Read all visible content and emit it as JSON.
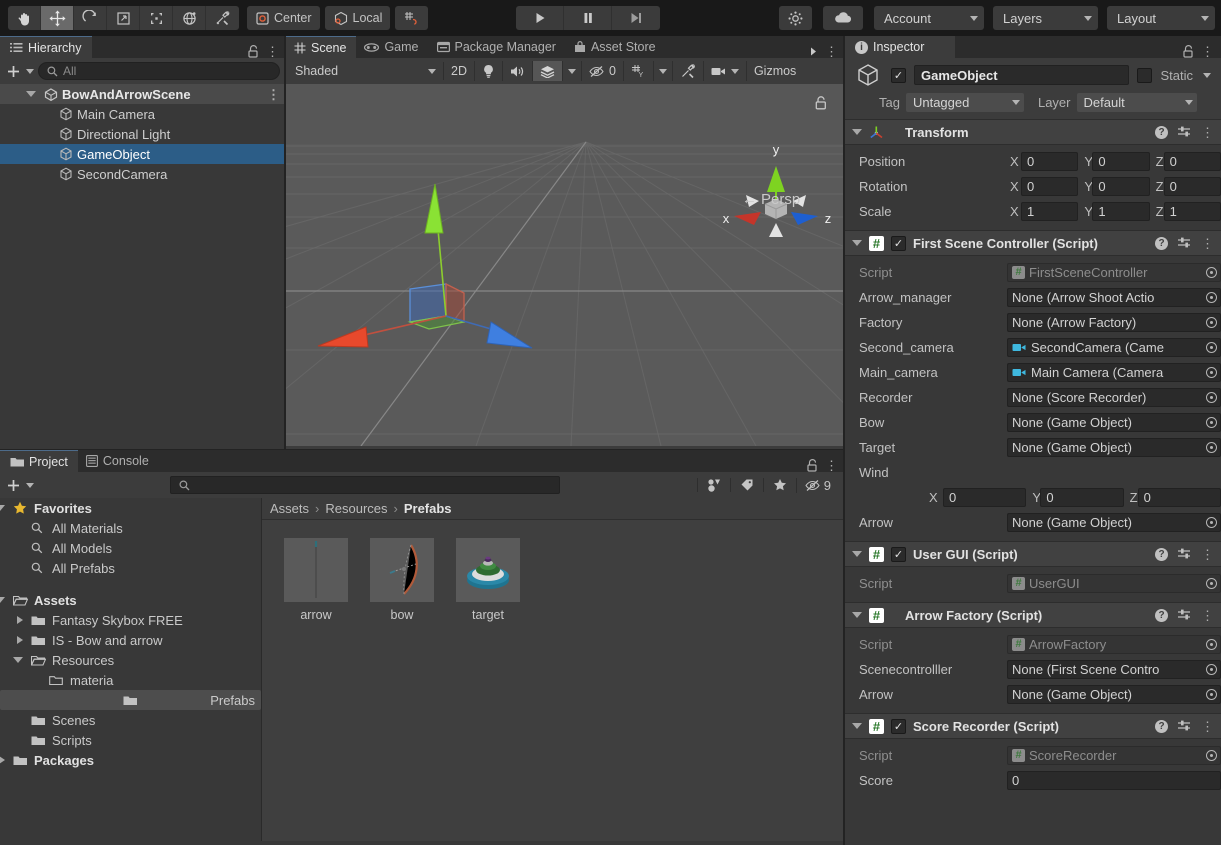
{
  "toolbar": {
    "tools": [
      {
        "name": "hand-tool",
        "icon": "hand",
        "active": false
      },
      {
        "name": "move-tool",
        "icon": "move",
        "active": true
      },
      {
        "name": "rotate-tool",
        "icon": "rotate",
        "active": false
      },
      {
        "name": "scale-tool",
        "icon": "scale",
        "active": false
      },
      {
        "name": "rect-tool",
        "icon": "rect",
        "active": false
      },
      {
        "name": "transform-tool",
        "icon": "transform",
        "active": false
      },
      {
        "name": "custom-tool",
        "icon": "wrench",
        "active": false
      }
    ],
    "pivot_label": "Center",
    "space_label": "Local",
    "grid_snap_label": "",
    "play_label": "▶",
    "pause_label": "❚❚",
    "step_label": "▶|",
    "account_label": "Account",
    "layers_label": "Layers",
    "layout_label": "Layout"
  },
  "hierarchy": {
    "tab_label": "Hierarchy",
    "add_label": "+",
    "search_placeholder": "All",
    "items": [
      {
        "label": "BowAndArrowScene",
        "depth": 0,
        "type": "scene",
        "selected": false,
        "expanded": true
      },
      {
        "label": "Main Camera",
        "depth": 1,
        "type": "object",
        "selected": false
      },
      {
        "label": "Directional Light",
        "depth": 1,
        "type": "object",
        "selected": false
      },
      {
        "label": "GameObject",
        "depth": 1,
        "type": "object",
        "selected": true
      },
      {
        "label": "SecondCamera",
        "depth": 1,
        "type": "object",
        "selected": false
      }
    ]
  },
  "scene": {
    "tabs": [
      {
        "label": "Scene",
        "icon": "grid-icon",
        "active": true
      },
      {
        "label": "Game",
        "icon": "gamepad-icon",
        "active": false
      },
      {
        "label": "Package Manager",
        "icon": "package-icon",
        "active": false
      },
      {
        "label": "Asset Store",
        "icon": "store-icon",
        "active": false
      }
    ],
    "shading_label": "Shaded",
    "mode_2d_label": "2D",
    "audio_count": "0",
    "gizmos_label": "Gizmos",
    "axis_x": "x",
    "axis_y": "y",
    "axis_z": "z",
    "persp_label": "Persp"
  },
  "inspector": {
    "tab_label": "Inspector",
    "object_name": "GameObject",
    "enabled": true,
    "static_label": "Static",
    "tag_label": "Tag",
    "tag_value": "Untagged",
    "layer_label": "Layer",
    "layer_value": "Default",
    "components": [
      {
        "title": "Transform",
        "icon": "transform-icon",
        "has_checkbox": false,
        "rows": [
          {
            "kind": "vector3",
            "label": "Position",
            "x": "0",
            "y": "0",
            "z": "0"
          },
          {
            "kind": "vector3",
            "label": "Rotation",
            "x": "0",
            "y": "0",
            "z": "0"
          },
          {
            "kind": "vector3",
            "label": "Scale",
            "x": "1",
            "y": "1",
            "z": "1"
          }
        ]
      },
      {
        "title": "First Scene Controller (Script)",
        "icon": "script-icon",
        "has_checkbox": true,
        "checked": true,
        "rows": [
          {
            "kind": "script",
            "label": "Script",
            "value": "FirstSceneController",
            "readonly": true
          },
          {
            "kind": "object",
            "label": "Arrow_manager",
            "value": "None (Arrow Shoot Actio",
            "badge": "none"
          },
          {
            "kind": "object",
            "label": "Factory",
            "value": "None (Arrow Factory)",
            "badge": "none"
          },
          {
            "kind": "object",
            "label": "Second_camera",
            "value": "SecondCamera (Came",
            "badge": "camera"
          },
          {
            "kind": "object",
            "label": "Main_camera",
            "value": "Main Camera (Camera",
            "badge": "camera"
          },
          {
            "kind": "object",
            "label": "Recorder",
            "value": "None (Score Recorder)",
            "badge": "none"
          },
          {
            "kind": "object",
            "label": "Bow",
            "value": "None (Game Object)",
            "badge": "none"
          },
          {
            "kind": "object",
            "label": "Target",
            "value": "None (Game Object)",
            "badge": "none"
          },
          {
            "kind": "label",
            "label": "Wind"
          },
          {
            "kind": "vector3-indent",
            "label": "",
            "x": "0",
            "y": "0",
            "z": "0"
          },
          {
            "kind": "object",
            "label": "Arrow",
            "value": "None (Game Object)",
            "badge": "none"
          }
        ]
      },
      {
        "title": "User GUI (Script)",
        "icon": "script-icon",
        "has_checkbox": true,
        "checked": true,
        "rows": [
          {
            "kind": "script",
            "label": "Script",
            "value": "UserGUI",
            "readonly": true
          }
        ]
      },
      {
        "title": "Arrow Factory (Script)",
        "icon": "script-icon",
        "has_checkbox": false,
        "rows": [
          {
            "kind": "script",
            "label": "Script",
            "value": "ArrowFactory",
            "readonly": true
          },
          {
            "kind": "object",
            "label": "Scenecontrolller",
            "value": "None (First Scene Contro",
            "badge": "none"
          },
          {
            "kind": "object",
            "label": "Arrow",
            "value": "None (Game Object)",
            "badge": "none"
          }
        ]
      },
      {
        "title": "Score Recorder (Script)",
        "icon": "script-icon",
        "has_checkbox": true,
        "checked": true,
        "rows": [
          {
            "kind": "script",
            "label": "Script",
            "value": "ScoreRecorder",
            "readonly": true
          },
          {
            "kind": "text",
            "label": "Score",
            "value": "0"
          }
        ]
      }
    ]
  },
  "project": {
    "tabs": [
      {
        "label": "Project",
        "icon": "folder-icon",
        "active": true
      },
      {
        "label": "Console",
        "icon": "console-icon",
        "active": false
      }
    ],
    "add_label": "+",
    "search_placeholder": "",
    "hidden_count": "9",
    "tree": [
      {
        "label": "Favorites",
        "depth": 0,
        "icon": "star-icon",
        "expanded": true,
        "bold": true
      },
      {
        "label": "All Materials",
        "depth": 1,
        "icon": "search-icon"
      },
      {
        "label": "All Models",
        "depth": 1,
        "icon": "search-icon"
      },
      {
        "label": "All Prefabs",
        "depth": 1,
        "icon": "search-icon"
      },
      {
        "label": "",
        "depth": 0,
        "icon": "spacer"
      },
      {
        "label": "Assets",
        "depth": 0,
        "icon": "folder-open-icon",
        "expanded": true,
        "bold": true
      },
      {
        "label": "Fantasy Skybox FREE",
        "depth": 1,
        "icon": "folder-icon",
        "collapsed": true
      },
      {
        "label": "IS - Bow and arrow",
        "depth": 1,
        "icon": "folder-icon",
        "collapsed": true
      },
      {
        "label": "Resources",
        "depth": 1,
        "icon": "folder-open-icon",
        "expanded": true
      },
      {
        "label": "materia",
        "depth": 2,
        "icon": "folder-empty-icon"
      },
      {
        "label": "Prefabs",
        "depth": 2,
        "icon": "folder-icon",
        "selected": true
      },
      {
        "label": "Scenes",
        "depth": 1,
        "icon": "folder-icon"
      },
      {
        "label": "Scripts",
        "depth": 1,
        "icon": "folder-icon"
      },
      {
        "label": "Packages",
        "depth": 0,
        "icon": "folder-icon",
        "collapsed": true,
        "bold": true
      }
    ],
    "breadcrumb": [
      "Assets",
      "Resources",
      "Prefabs"
    ],
    "assets": [
      {
        "name": "arrow",
        "thumb": "arrow"
      },
      {
        "name": "bow",
        "thumb": "bow"
      },
      {
        "name": "target",
        "thumb": "target"
      }
    ]
  },
  "colors": {
    "accent": "#2c5d87",
    "panel": "#383838",
    "toolbar": "#191919",
    "field": "#2a2a2a",
    "axis_x": "#c8402f",
    "axis_y": "#7ed321",
    "axis_z": "#3a78d8"
  }
}
